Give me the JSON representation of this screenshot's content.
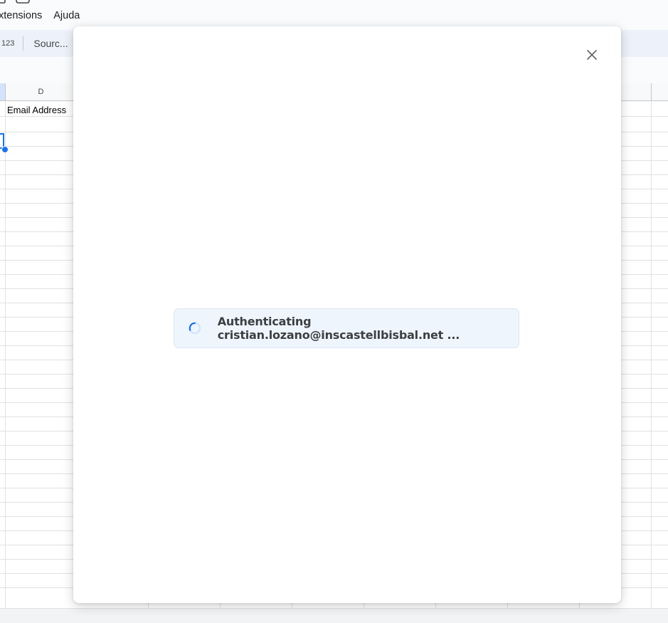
{
  "menu": {
    "items": [
      "xtensions",
      "Ajuda"
    ]
  },
  "toolbar": {
    "number_format_label": "123",
    "font_label": "Sourc..."
  },
  "sheet": {
    "column_headers": [
      "D"
    ],
    "cells": {
      "D1": "Email Address"
    }
  },
  "dialog": {
    "auth_message": "Authenticating cristian.lozano@inscastellbisbal.net ...",
    "close_icon": "close-icon",
    "spinner_icon": "loading-spinner-icon"
  },
  "colors": {
    "accent": "#1a73e8",
    "toolbar_bg": "#edf2fa",
    "auth_bg": "#eff5fd"
  }
}
